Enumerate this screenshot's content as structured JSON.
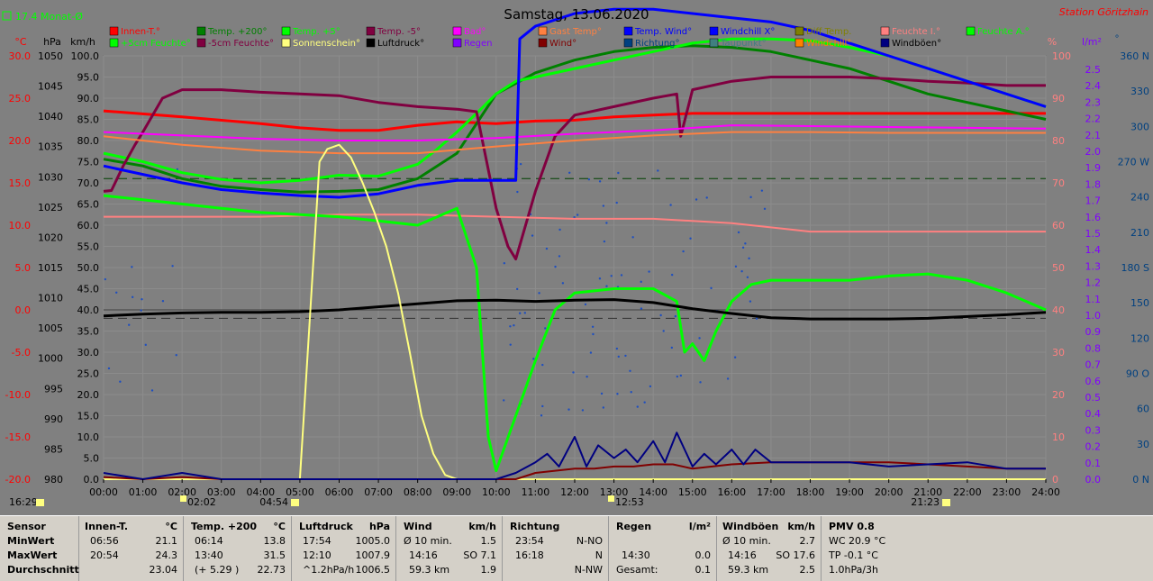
{
  "header": {
    "title": "Samstag, 13.06.2020",
    "station": "Station Göritzhain",
    "month_indicator": "17.4 Monat-Ø"
  },
  "axis_units": {
    "temp": "°C",
    "press": "hPa",
    "wind": "km/h",
    "pct": "%",
    "rain": "l/m²",
    "dir": "°"
  },
  "axes": {
    "temp": [
      "30.0",
      "25.0",
      "20.0",
      "15.0",
      "10.0",
      "5.0",
      "0.0",
      "-5.0",
      "-10.0",
      "-15.0",
      "-20.0"
    ],
    "press": [
      "1050",
      "1045",
      "1040",
      "1035",
      "1030",
      "1025",
      "1020",
      "1015",
      "1010",
      "1005",
      "1000",
      "995",
      "990",
      "985",
      "980"
    ],
    "wind": [
      "100.0",
      "95.0",
      "90.0",
      "85.0",
      "80.0",
      "75.0",
      "70.0",
      "65.0",
      "60.0",
      "55.0",
      "50.0",
      "45.0",
      "40.0",
      "35.0",
      "30.0",
      "25.0",
      "20.0",
      "15.0",
      "10.0",
      "5.0",
      "0.0"
    ],
    "pct": [
      "100",
      "90",
      "80",
      "70",
      "60",
      "50",
      "40",
      "30",
      "20",
      "10",
      "0"
    ],
    "rain": [
      "2.5",
      "2.4",
      "2.3",
      "2.2",
      "2.1",
      "2.0",
      "1.9",
      "1.8",
      "1.7",
      "1.6",
      "1.5",
      "1.4",
      "1.3",
      "1.2",
      "1.1",
      "1.0",
      "0.9",
      "0.8",
      "0.7",
      "0.6",
      "0.5",
      "0.4",
      "0.3",
      "0.2",
      "0.1",
      "0.0"
    ],
    "dir": [
      "360 N",
      "330",
      "300",
      "270 W",
      "240",
      "210",
      "180 S",
      "150",
      "120",
      "90 O",
      "60",
      "30",
      "0 N"
    ],
    "time": [
      "00:00",
      "01:00",
      "02:00",
      "03:00",
      "04:00",
      "05:00",
      "06:00",
      "07:00",
      "08:00",
      "09:00",
      "10:00",
      "11:00",
      "12:00",
      "13:00",
      "14:00",
      "15:00",
      "16:00",
      "17:00",
      "18:00",
      "19:00",
      "20:00",
      "21:00",
      "22:00",
      "23:00",
      "24:00"
    ]
  },
  "markers": {
    "sunrise": "04:54",
    "sunset": "21:23",
    "moonrise": "02:02",
    "moonset": "12:53",
    "daylength": "16:29"
  },
  "legend": [
    {
      "label": "Innen-T.°",
      "color": "#ff0000"
    },
    {
      "label": "Temp. +200°",
      "color": "#008000"
    },
    {
      "label": "Temp. +5°",
      "color": "#00ff00"
    },
    {
      "label": "Temp. -5°",
      "color": "#800040"
    },
    {
      "label": "Bad°",
      "color": "#ff00ff"
    },
    {
      "label": "Gast Temp°",
      "color": "#ff8040"
    },
    {
      "label": "Temp. Wind°",
      "color": "#0000ff"
    },
    {
      "label": "Windchill X°",
      "color": "#0000ff"
    },
    {
      "label": "Diff Temp.",
      "color": "#808000"
    },
    {
      "label": "Feuchte I.°",
      "color": "#ff8080"
    },
    {
      "label": "Feuchte A.°",
      "color": "#00ff00"
    },
    {
      "label": "+5cm Feuchte°",
      "color": "#00ff00"
    },
    {
      "label": "-5cm Feuchte°",
      "color": "#800040"
    },
    {
      "label": "Sonnenschein°",
      "color": "#ffff80"
    },
    {
      "label": "Luftdruck°",
      "color": "#000000"
    },
    {
      "label": "Regen",
      "color": "#8000ff"
    },
    {
      "label": "Wind°",
      "color": "#800000"
    },
    {
      "label": "Richtung°",
      "color": "#004080"
    },
    {
      "label": "Taupunkt°",
      "color": "#408080"
    },
    {
      "label": "Windchill°",
      "color": "#ff8000"
    },
    {
      "label": "Windböen°",
      "color": "#000080"
    }
  ],
  "chart_data": {
    "type": "line",
    "title": "Samstag, 13.06.2020",
    "x_unit": "hour of day",
    "xlim": [
      0,
      24
    ],
    "series": [
      {
        "name": "Innen-T.°",
        "axis": "temp",
        "color": "#ff0000",
        "x": [
          0,
          2,
          4,
          5,
          6,
          7,
          8,
          9,
          10,
          11,
          12,
          13,
          14,
          15,
          16,
          18,
          20,
          22,
          24
        ],
        "y": [
          23.5,
          22.8,
          22.0,
          21.5,
          21.2,
          21.2,
          21.8,
          22.2,
          22.0,
          22.3,
          22.4,
          22.8,
          23.0,
          23.2,
          23.2,
          23.2,
          23.2,
          23.2,
          23.2
        ]
      },
      {
        "name": "Temp. +200°",
        "axis": "temp",
        "color": "#008000",
        "x": [
          0,
          1,
          2,
          3,
          4,
          5,
          6,
          7,
          8,
          9,
          10,
          11,
          12,
          13,
          14,
          15,
          16,
          17,
          18,
          19,
          20,
          21,
          22,
          23,
          24
        ],
        "y": [
          17.8,
          17.0,
          15.5,
          14.6,
          14.2,
          13.9,
          14.0,
          14.2,
          15.5,
          18.5,
          25.5,
          28.0,
          29.5,
          30.5,
          31.0,
          31.2,
          31.0,
          30.5,
          29.5,
          28.5,
          27.0,
          25.5,
          24.5,
          23.5,
          22.5
        ]
      },
      {
        "name": "Temp. +5°",
        "axis": "temp",
        "color": "#00ff00",
        "x": [
          0,
          1,
          2,
          3,
          4,
          5,
          6,
          7,
          8,
          8.5,
          9,
          9.5,
          10,
          10.5,
          11,
          12,
          13,
          14,
          15,
          16,
          17,
          18,
          19,
          20,
          21,
          22,
          23,
          24
        ],
        "y": [
          18.5,
          17.5,
          16.2,
          15.4,
          15.0,
          15.3,
          15.9,
          15.8,
          17.2,
          19.0,
          21.0,
          23.2,
          25.5,
          27.0,
          27.5,
          28.5,
          29.5,
          30.5,
          31.5,
          32.0,
          32.0,
          31.8,
          31.0,
          30.0,
          28.5,
          27.0,
          25.5,
          24.0
        ]
      },
      {
        "name": "Temp. -5°",
        "axis": "temp",
        "color": "#800040",
        "x": [
          0,
          0.2,
          0.5,
          0.8,
          1.0,
          1.5,
          2,
          3,
          4,
          5,
          6,
          7,
          8,
          9,
          9.5,
          10,
          10.3,
          10.5,
          11,
          11.5,
          12,
          13,
          14,
          14.6,
          14.7,
          15,
          16,
          17,
          18,
          19,
          20,
          21,
          22,
          23,
          24
        ],
        "y": [
          14.0,
          14.1,
          17.0,
          19.5,
          21.0,
          25.0,
          26.0,
          26.0,
          25.7,
          25.5,
          25.3,
          24.5,
          24.0,
          23.7,
          23.4,
          12.0,
          7.5,
          6.0,
          14.0,
          20.5,
          23.0,
          24.0,
          25.0,
          25.5,
          20.5,
          26.0,
          27.0,
          27.5,
          27.5,
          27.5,
          27.3,
          27.0,
          26.8,
          26.5,
          26.5
        ]
      },
      {
        "name": "Bad°",
        "axis": "temp",
        "color": "#ff00ff",
        "x": [
          0,
          2,
          4,
          6,
          8,
          10,
          12,
          14,
          16,
          18,
          20,
          22,
          24
        ],
        "y": [
          21.0,
          20.6,
          20.2,
          20.0,
          20.0,
          20.3,
          20.8,
          21.2,
          21.8,
          21.7,
          21.6,
          21.5,
          21.4
        ]
      },
      {
        "name": "Gast Temp°",
        "axis": "temp",
        "color": "#ff8040",
        "x": [
          0,
          2,
          4,
          6,
          8,
          10,
          12,
          14,
          16,
          18,
          20,
          22,
          24
        ],
        "y": [
          20.5,
          19.5,
          18.8,
          18.5,
          18.5,
          19.3,
          20.0,
          20.6,
          21.0,
          21.0,
          20.9,
          20.9,
          20.9
        ]
      },
      {
        "name": "Temp. Wind°",
        "axis": "temp",
        "color": "#0000ff",
        "x": [
          0,
          1,
          2,
          3,
          4,
          5,
          6,
          7,
          8,
          9,
          10,
          10.5,
          10.6,
          11,
          12,
          13,
          14,
          15,
          16,
          17,
          18,
          19,
          20,
          21,
          22,
          23,
          24
        ],
        "y": [
          17.0,
          16.0,
          15.0,
          14.2,
          13.8,
          13.5,
          13.3,
          13.7,
          14.7,
          15.3,
          15.3,
          15.3,
          32.0,
          33.5,
          35.0,
          35.5,
          35.5,
          35.0,
          34.5,
          34.0,
          33.0,
          31.5,
          30.0,
          28.5,
          27.0,
          25.5,
          24.0
        ]
      },
      {
        "name": "Feuchte I.°",
        "axis": "pct",
        "color": "#ff8080",
        "x": [
          0,
          2,
          4,
          6,
          8,
          10,
          12,
          14,
          16,
          18,
          20,
          22,
          24
        ],
        "y": [
          62,
          62,
          62,
          62.5,
          62.5,
          62,
          61.5,
          61.5,
          60.5,
          58.5,
          58.5,
          58.5,
          58.5
        ]
      },
      {
        "name": "Feuchte A.°",
        "axis": "pct",
        "color": "#00ff00",
        "x": [
          0,
          1,
          2,
          3,
          4,
          5,
          6,
          7,
          8,
          9,
          9.5,
          9.8,
          10.0,
          10.5,
          11,
          11.5,
          12,
          13,
          14,
          14.6,
          14.8,
          15.0,
          15.3,
          15.6,
          16,
          16.5,
          17,
          18,
          19,
          20,
          21,
          22,
          23,
          24
        ],
        "y": [
          67,
          66,
          65,
          64,
          63,
          62.5,
          62,
          61,
          60,
          64,
          50,
          10,
          2,
          15,
          28,
          40,
          44,
          45,
          45,
          42,
          30,
          32,
          28,
          35,
          42,
          46,
          47,
          47,
          47,
          48,
          48.5,
          47,
          44,
          40
        ]
      },
      {
        "name": "Luftdruck°",
        "axis": "press",
        "color": "#000000",
        "x": [
          0,
          1,
          2,
          3,
          4,
          5,
          6,
          7,
          8,
          9,
          10,
          11,
          12,
          13,
          14,
          15,
          16,
          17,
          18,
          19,
          20,
          21,
          22,
          23,
          24
        ],
        "y": [
          1007.0,
          1007.3,
          1007.5,
          1007.6,
          1007.6,
          1007.7,
          1008.0,
          1008.5,
          1009.0,
          1009.5,
          1009.6,
          1009.4,
          1009.6,
          1009.7,
          1009.2,
          1008.2,
          1007.4,
          1006.7,
          1006.5,
          1006.5,
          1006.5,
          1006.6,
          1006.9,
          1007.2,
          1007.6
        ]
      },
      {
        "name": "Sonnenschein°",
        "axis": "wind",
        "color": "#ffff80",
        "x": [
          0,
          4.9,
          5.0,
          5.1,
          5.3,
          5.5,
          5.7,
          6.0,
          6.3,
          6.6,
          6.9,
          7.2,
          7.5,
          7.8,
          8.1,
          8.4,
          8.7,
          9,
          24
        ],
        "y": [
          0,
          0,
          0,
          15,
          45,
          75,
          78,
          79,
          76,
          70,
          63,
          55,
          44,
          30,
          15,
          6,
          1,
          0,
          0
        ]
      },
      {
        "name": "Wind°",
        "axis": "wind",
        "color": "#800000",
        "x": [
          0,
          1,
          2,
          3,
          4,
          5,
          6,
          7,
          8,
          9,
          10,
          10.5,
          11,
          11.5,
          12,
          12.5,
          13,
          13.5,
          14,
          14.5,
          15,
          15.5,
          16,
          17,
          18,
          19,
          20,
          21,
          22,
          23,
          24
        ],
        "y": [
          0.5,
          0,
          0.5,
          0,
          0,
          0,
          0,
          0,
          0,
          0,
          0,
          0,
          1.5,
          2.0,
          2.5,
          2.5,
          3.0,
          3.0,
          3.5,
          3.5,
          2.5,
          3.0,
          3.5,
          4.0,
          4.0,
          4.0,
          4.0,
          3.5,
          3.0,
          2.5,
          2.5
        ]
      },
      {
        "name": "Windböen°",
        "axis": "wind",
        "color": "#000080",
        "x": [
          0,
          1,
          2,
          3,
          4,
          5,
          6,
          7,
          8,
          9,
          10,
          10.5,
          11,
          11.3,
          11.6,
          12,
          12.3,
          12.6,
          13,
          13.3,
          13.6,
          14,
          14.3,
          14.6,
          15,
          15.3,
          15.6,
          16,
          16.3,
          16.6,
          17,
          18,
          19,
          20,
          21,
          22,
          23,
          24
        ],
        "y": [
          1.5,
          0,
          1.5,
          0,
          0,
          0,
          0,
          0,
          0,
          0,
          0,
          1.5,
          4.0,
          6.0,
          3.0,
          10.0,
          3.0,
          8.0,
          5.0,
          7.0,
          4.0,
          9.0,
          4.0,
          11.0,
          3.0,
          6.0,
          3.5,
          7.0,
          3.5,
          7.0,
          4.0,
          4.0,
          4.0,
          3.0,
          3.5,
          4.0,
          2.5,
          2.5
        ]
      }
    ]
  },
  "summary": {
    "sensor": {
      "title": "Sensor",
      "rows": [
        "MinWert",
        "MaxWert",
        "Durchschnitt"
      ]
    },
    "innen": {
      "title": "Innen-T.",
      "unit": "°C",
      "rows": [
        [
          "06:56",
          "21.1"
        ],
        [
          "20:54",
          "24.3"
        ],
        [
          "",
          "23.04"
        ]
      ]
    },
    "temp200": {
      "title": "Temp. +200",
      "unit": "°C",
      "rows": [
        [
          "06:14",
          "13.8"
        ],
        [
          "13:40",
          "31.5"
        ],
        [
          "(+ 5.29 )",
          "22.73"
        ]
      ]
    },
    "luftdruck": {
      "title": "Luftdruck",
      "unit": "hPa",
      "rows": [
        [
          "17:54",
          "1005.0"
        ],
        [
          "12:10",
          "1007.9"
        ],
        [
          "^1.2hPa/h",
          "1006.5"
        ]
      ]
    },
    "wind": {
      "title": "Wind",
      "unit": "km/h",
      "rows": [
        [
          "Ø 10 min.",
          "1.5"
        ],
        [
          "14:16",
          "SO 7.1"
        ],
        [
          "59.3 km",
          "1.9"
        ]
      ]
    },
    "richtung": {
      "title": "Richtung",
      "unit": "",
      "rows": [
        [
          "23:54",
          "N-NO"
        ],
        [
          "16:18",
          "N"
        ],
        [
          "",
          "N-NW"
        ]
      ]
    },
    "regen": {
      "title": "Regen",
      "unit": "l/m²",
      "rows": [
        [
          "",
          ""
        ],
        [
          "14:30",
          "0.0"
        ],
        [
          "Gesamt:",
          "0.1"
        ]
      ]
    },
    "boeen": {
      "title": "Windböen",
      "unit": "km/h",
      "rows": [
        [
          "Ø 10 min.",
          "2.7"
        ],
        [
          "14:16",
          "SO 17.6"
        ],
        [
          "59.3 km",
          "2.5"
        ]
      ]
    },
    "pmv": {
      "title": "PMV 0.8",
      "rows": [
        "WC 20.9 °C",
        "TP -0.1 °C",
        "1.0hPa/3h"
      ]
    }
  }
}
